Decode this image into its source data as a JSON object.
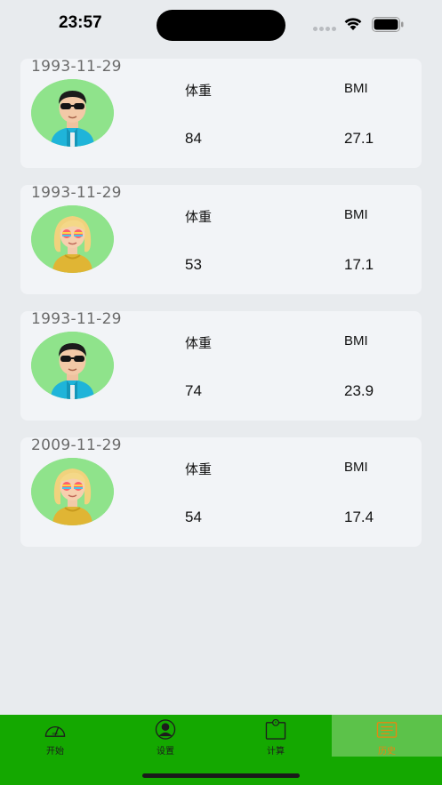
{
  "status": {
    "time": "23:57"
  },
  "records": [
    {
      "date": "1993-11-29",
      "weight_label": "体重",
      "bmi_label": "BMI",
      "weight": "84",
      "bmi": "27.1",
      "avatar": "male-avatar"
    },
    {
      "date": "1993-11-29",
      "weight_label": "体重",
      "bmi_label": "BMI",
      "weight": "53",
      "bmi": "17.1",
      "avatar": "female-avatar"
    },
    {
      "date": "1993-11-29",
      "weight_label": "体重",
      "bmi_label": "BMI",
      "weight": "74",
      "bmi": "23.9",
      "avatar": "male-avatar"
    },
    {
      "date": "2009-11-29",
      "weight_label": "体重",
      "bmi_label": "BMI",
      "weight": "54",
      "bmi": "17.4",
      "avatar": "female-avatar"
    }
  ],
  "tabbar": {
    "items": [
      {
        "label": "开始",
        "icon": "scale-icon"
      },
      {
        "label": "设置",
        "icon": "user-icon"
      },
      {
        "label": "计算",
        "icon": "calculator-icon"
      },
      {
        "label": "历史",
        "icon": "history-icon"
      }
    ],
    "active_index": 3,
    "colors": {
      "background": "#14a800",
      "active_bg": "#5cc24a",
      "active_text": "#e8860f"
    }
  }
}
